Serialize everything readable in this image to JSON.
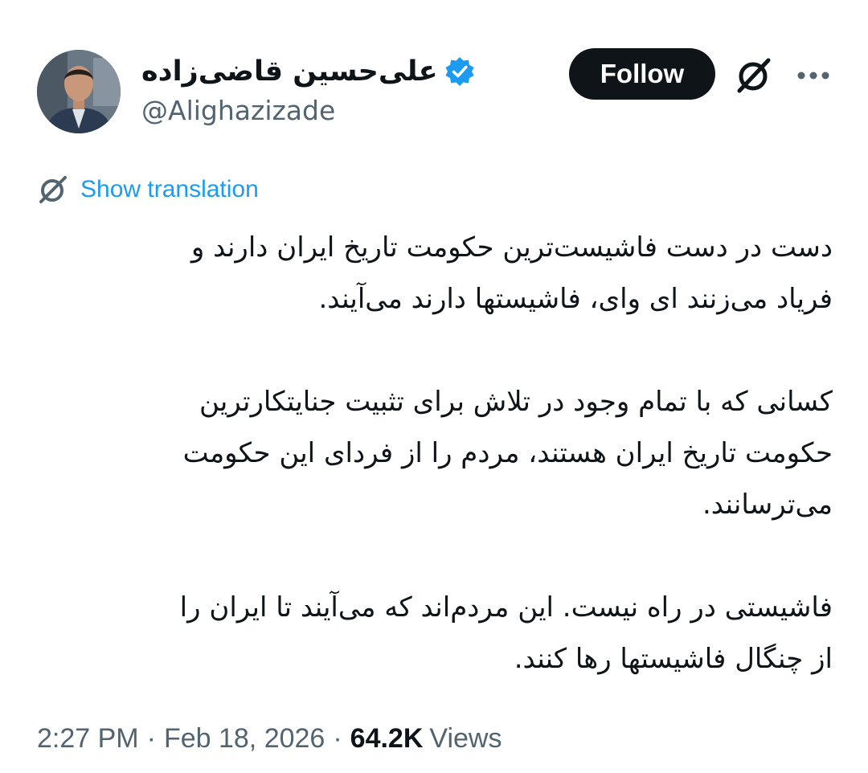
{
  "author": {
    "display_name": "علی‌حسین قاضی‌زاده",
    "handle": "@Alighazizade",
    "avatar_icon": "profile-photo",
    "verified_icon": "verified-badge-icon",
    "verified_color": "#1d9bf0"
  },
  "actions": {
    "follow_label": "Follow",
    "grok_icon": "grok-icon",
    "more_icon": "more-icon"
  },
  "translation": {
    "label": "Show translation",
    "icon": "translate-icon",
    "color": "#1d9bf0"
  },
  "tweet": {
    "paragraphs": [
      {
        "lines": [
          "دست در دست فاشیست‌ترین حکومت تاریخ ایران دارند و",
          "فریاد می‌زنند ای وای، فاشیستها دارند می‌آیند."
        ]
      },
      {
        "lines": [
          "کسانی که با تمام وجود در تلاش برای تثبیت جنایتکارترین",
          "حکومت تاریخ ایران هستند، مردم را از فردای این حکومت",
          "می‌ترسانند."
        ]
      },
      {
        "lines": [
          "فاشیستی در راه نیست. این مردم‌اند که می‌آیند تا ایران را",
          "از چنگال فاشیستها رها کنند."
        ]
      }
    ]
  },
  "meta": {
    "time": "2:27 PM",
    "separator": "·",
    "date": "Feb 18, 2026",
    "views_count": "64.2K",
    "views_label": "Views"
  }
}
